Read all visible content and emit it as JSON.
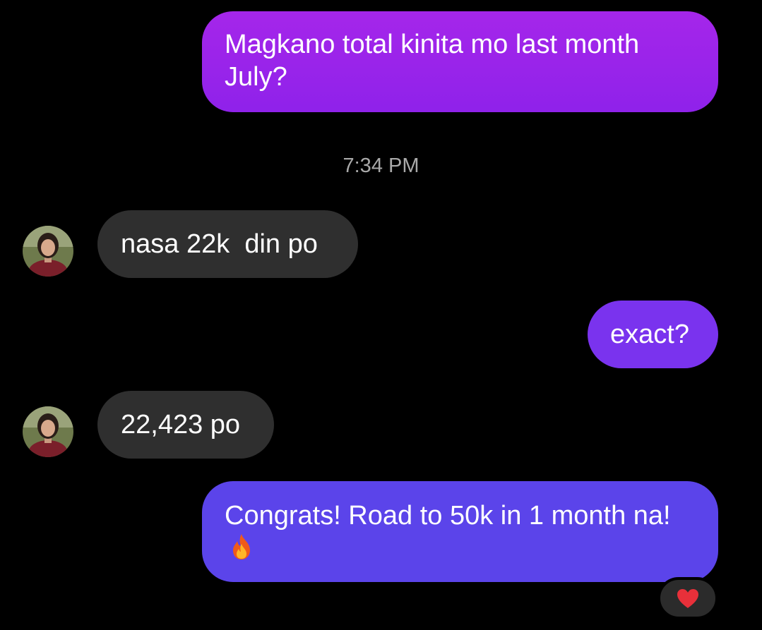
{
  "conversation": {
    "messages": [
      {
        "sender": "me",
        "text": "Magkano total kinita mo last month July?"
      },
      {
        "sender": "contact",
        "text": "nasa 22k  din po"
      },
      {
        "sender": "me",
        "text": "exact?"
      },
      {
        "sender": "contact",
        "text": "22,423 po"
      },
      {
        "sender": "me",
        "text": "Congrats! Road to 50k in 1 month na!",
        "emoji": "fire-icon"
      }
    ],
    "timestamp": "7:34 PM",
    "reaction": {
      "icon": "heart-icon",
      "color": "#e8303a"
    }
  },
  "colors": {
    "background": "#000000",
    "sent_bubble_top": "#a526ea",
    "sent_bubble_bottom": "#5b44ea",
    "received_bubble": "#2f2f2f",
    "timestamp_text": "#a9a9a9"
  }
}
